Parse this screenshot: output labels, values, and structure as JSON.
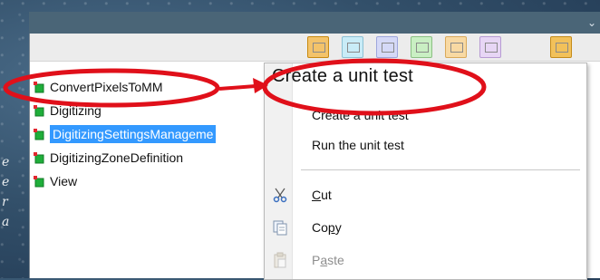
{
  "background": {
    "side_text": [
      "e",
      "e",
      "r",
      "a"
    ]
  },
  "window": {
    "chevron_glyph": "⌄"
  },
  "toolbar": {
    "buttons": [
      {
        "name": "toolbar-button-1",
        "color": "#f3c36a",
        "border": "#c88a10"
      },
      {
        "name": "toolbar-button-2",
        "color": "#c9ecf7",
        "border": "#8cc1d4"
      },
      {
        "name": "toolbar-button-3",
        "color": "#d5d9f7",
        "border": "#9ea6dc"
      },
      {
        "name": "toolbar-button-4",
        "color": "#c9efc3",
        "border": "#8bc083"
      },
      {
        "name": "toolbar-button-5",
        "color": "#f8d9a3",
        "border": "#d9a95a"
      },
      {
        "name": "toolbar-button-6",
        "color": "#e7d6f5",
        "border": "#b79bd3"
      },
      {
        "name": "toolbar-button-7",
        "color": "#f2c15a",
        "border": "#c48b1a"
      }
    ]
  },
  "tree": {
    "items": [
      {
        "label": "ConvertPixelsToMM",
        "selected": false
      },
      {
        "label": "Digitizing",
        "selected": false
      },
      {
        "label": "DigitizingSettingsManageme",
        "selected": true
      },
      {
        "label": "DigitizingZoneDefinition",
        "selected": false
      },
      {
        "label": "View",
        "selected": false
      }
    ]
  },
  "context_menu": {
    "items": [
      {
        "label": "Create a unit test",
        "disabled": false
      },
      {
        "label": "Run the unit test",
        "disabled": false
      },
      {
        "label": "Cut",
        "mnemonic": "C",
        "rest": "ut",
        "icon": "scissors-icon",
        "disabled": false
      },
      {
        "label": "Copy",
        "mnemonic": "p",
        "pre": "Co",
        "rest": "y",
        "icon": "copy-icon",
        "disabled": false
      },
      {
        "label": "Paste",
        "mnemonic": "a",
        "pre": "P",
        "rest": "ste",
        "icon": "paste-icon",
        "disabled": true
      }
    ]
  },
  "annotation": {
    "callout_text": "Create a unit test",
    "highlight_color": "#e0101a"
  }
}
